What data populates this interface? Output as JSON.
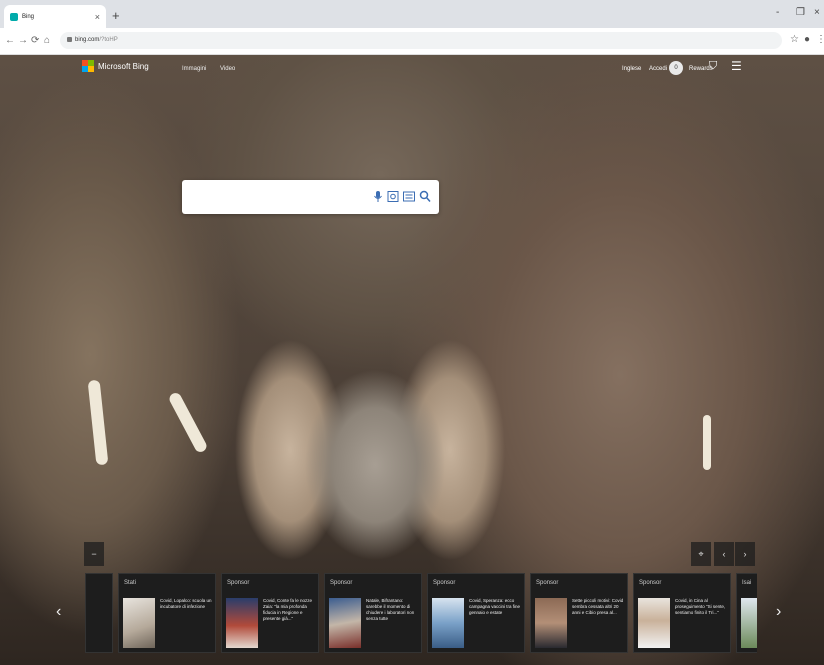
{
  "browser": {
    "tab_title": "Bing",
    "tab_close": "×",
    "new_tab": "+",
    "window_controls": [
      "-",
      "❐",
      "×"
    ],
    "nav_buttons": [
      "←",
      "→",
      "⟳",
      "⌂"
    ],
    "address": {
      "host": "bing.com",
      "path": "/?toHP"
    },
    "toolbar_icons": [
      "star-icon",
      "profile-icon",
      "menu-icon"
    ]
  },
  "bing": {
    "logo_text": "Microsoft Bing",
    "logo_colors": [
      "#f25022",
      "#7fba00",
      "#00a4ef",
      "#ffb900"
    ],
    "top_links": [
      "Immagini",
      "Video"
    ],
    "top_right": {
      "language": "Inglese",
      "user": "Accedi",
      "points": "0",
      "rewards": "Rewards"
    },
    "search": {
      "placeholder": "",
      "icons": [
        "mic-icon",
        "visual-search-icon",
        "keyboard-icon",
        "search-icon"
      ]
    }
  },
  "carousel": {
    "prev_arrow": "‹",
    "next_arrow": "›",
    "collapse": "−",
    "location": "⌖",
    "pager": [
      "‹",
      "›"
    ],
    "cards": [
      {
        "label": "",
        "headline": "",
        "partial": true
      },
      {
        "label": "Stati",
        "headline": "Covid, Lopalco: scuola un incubatore di infezione"
      },
      {
        "label": "Sponsor",
        "headline": "Covid, Conte fa le nozze Zaia: \"la mia profonda fiducia in Regione e presente già...\""
      },
      {
        "label": "Sponsor",
        "headline": "Natale, Bifrantano: sarebbe il momento di chiudere i laboratori non senza tutte"
      },
      {
        "label": "Sponsor",
        "headline": "Covid, Speranza: ecco campagna vaccini tra fine gennaio e estate"
      },
      {
        "label": "Sponsor",
        "headline": "Sette piccoli motivi: Covid sembra cessata altri 20 anni e Cibio presa al..."
      },
      {
        "label": "Sponsor",
        "headline": "Covid, in Cina al proseguimento \"Si sente, sentiamo finito il Tri...\""
      },
      {
        "label": "Isai",
        "headline": "",
        "partial": true
      }
    ]
  }
}
